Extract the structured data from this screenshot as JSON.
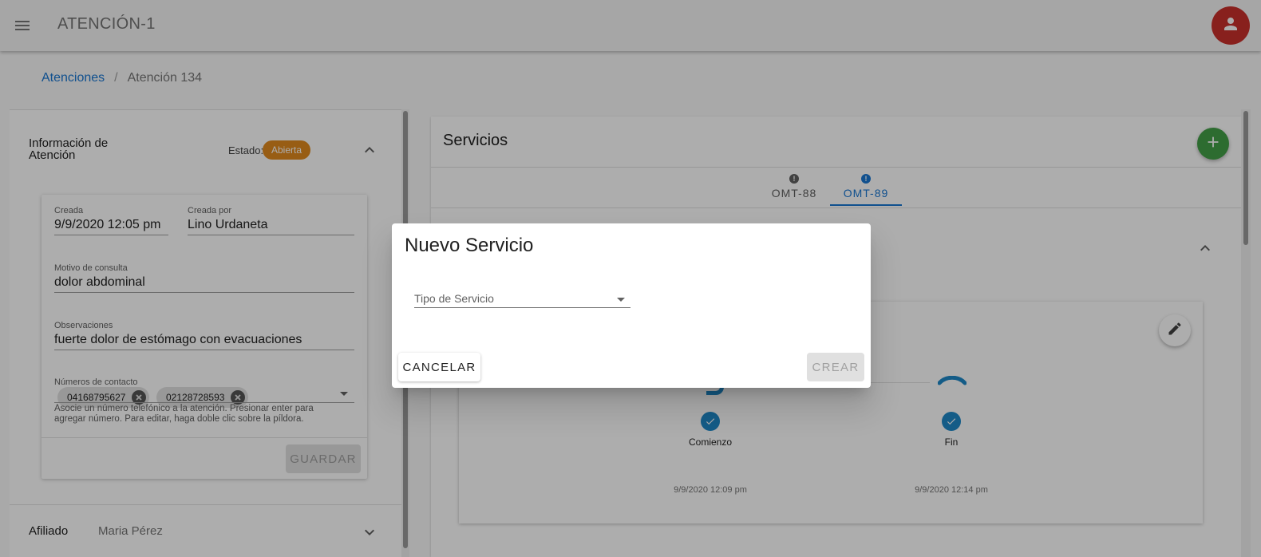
{
  "app": {
    "title": "ATENCIÓN-1"
  },
  "breadcrumb": {
    "parent": "Atenciones",
    "separator": "/",
    "current": "Atención 134"
  },
  "info_panel": {
    "title": "Información de Atención",
    "estado_label": "Estado:",
    "estado_value": "Abierta",
    "estado_color": "#e0891e",
    "fields": {
      "creada_label": "Creada",
      "creada_value": "9/9/2020 12:05 pm",
      "creada_por_label": "Creada por",
      "creada_por_value": "Lino Urdaneta",
      "motivo_label": "Motivo de consulta",
      "motivo_value": "dolor abdominal",
      "observaciones_label": "Observaciones",
      "observaciones_value": "fuerte dolor de estómago con evacuaciones",
      "contacto_label": "Números de contacto",
      "contactos": [
        "04168795627",
        "02128728593"
      ],
      "contacto_hint": "Asocie un número telefónico a la atención. Presionar enter para agregar número. Para editar, haga doble clic sobre la píldora."
    },
    "save_label": "GUARDAR"
  },
  "afiliado": {
    "label": "Afiliado",
    "value": "Maria Pérez"
  },
  "servicios": {
    "title": "Servicios",
    "tabs": [
      {
        "label": "OMT-88",
        "active": false,
        "dot_color": "#616161"
      },
      {
        "label": "OMT-89",
        "active": true,
        "dot_color": "#1976d2"
      }
    ],
    "steps": [
      {
        "label": "Comienzo",
        "date": "9/9/2020 12:09 pm"
      },
      {
        "label": "Fin",
        "date": "9/9/2020 12:14 pm"
      }
    ]
  },
  "dialog": {
    "title": "Nuevo Servicio",
    "select_label": "Tipo de Servicio",
    "cancel_label": "CANCELAR",
    "create_label": "CREAR"
  },
  "colors": {
    "accent": "#1976d2",
    "avatar": "#c9302c",
    "fab": "#43a047",
    "step": "#1e88c8"
  },
  "icons": [
    "menu-icon",
    "person-icon",
    "chevron-up-icon",
    "chevron-down-icon",
    "cancel-icon",
    "plus-icon",
    "pencil-icon",
    "check-icon",
    "phone-icon"
  ]
}
